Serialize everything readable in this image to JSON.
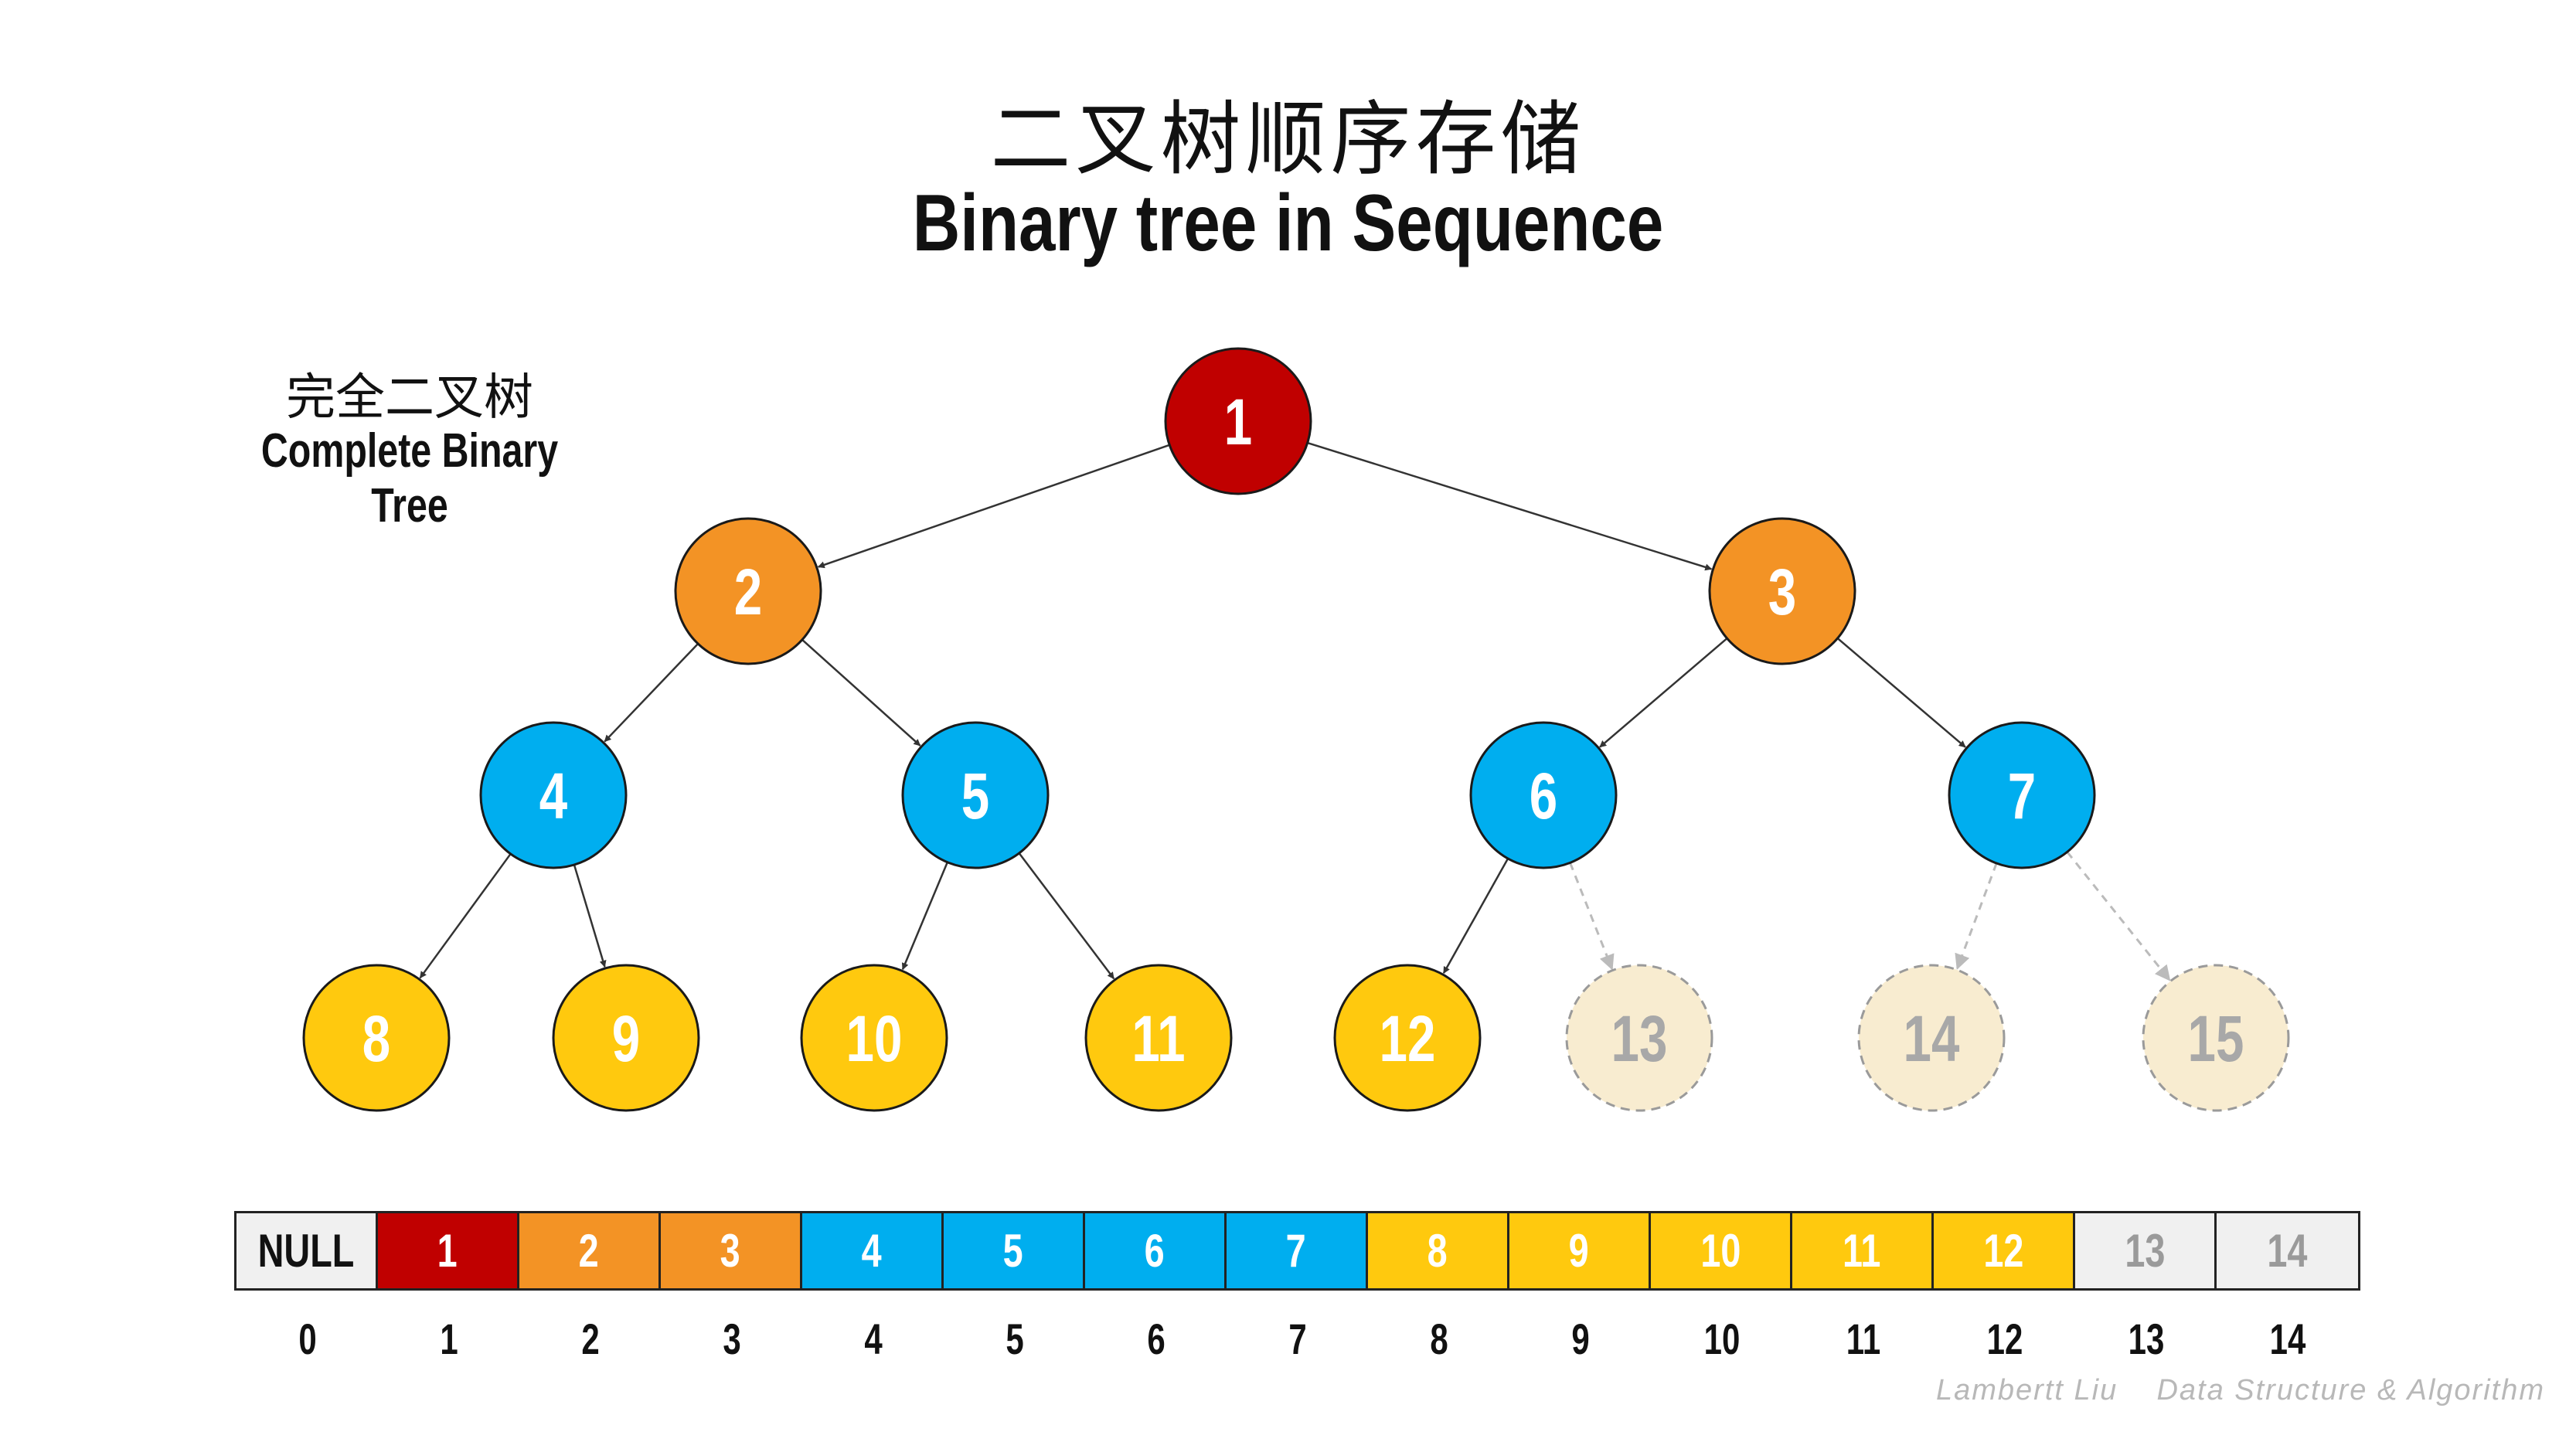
{
  "title_zh": "二叉树顺序存储",
  "title_en": "Binary tree in Sequence",
  "subtitle_zh": "完全二叉树",
  "subtitle_en": "Complete Binary Tree",
  "colors": {
    "level1": "#c00000",
    "level2": "#f39325",
    "level3": "#00aeef",
    "level4": "#ffc90e",
    "ghost_fill": "#f8ecd0",
    "null_fill": "#f0f0f0",
    "edge": "#333333",
    "ghost_edge": "#bbbbbb"
  },
  "tree_nodes": [
    {
      "label": "1",
      "color": "#c00000",
      "present": true
    },
    {
      "label": "2",
      "color": "#f39325",
      "present": true
    },
    {
      "label": "3",
      "color": "#f39325",
      "present": true
    },
    {
      "label": "4",
      "color": "#00aeef",
      "present": true
    },
    {
      "label": "5",
      "color": "#00aeef",
      "present": true
    },
    {
      "label": "6",
      "color": "#00aeef",
      "present": true
    },
    {
      "label": "7",
      "color": "#00aeef",
      "present": true
    },
    {
      "label": "8",
      "color": "#ffc90e",
      "present": true
    },
    {
      "label": "9",
      "color": "#ffc90e",
      "present": true
    },
    {
      "label": "10",
      "color": "#ffc90e",
      "present": true
    },
    {
      "label": "11",
      "color": "#ffc90e",
      "present": true
    },
    {
      "label": "12",
      "color": "#ffc90e",
      "present": true
    },
    {
      "label": "13",
      "color": "#f8ecd0",
      "present": false
    },
    {
      "label": "14",
      "color": "#f8ecd0",
      "present": false
    },
    {
      "label": "15",
      "color": "#f8ecd0",
      "present": false
    }
  ],
  "array_cells": [
    {
      "label": "NULL",
      "color": "#f0f0f0",
      "kind": "null"
    },
    {
      "label": "1",
      "color": "#c00000",
      "kind": "value"
    },
    {
      "label": "2",
      "color": "#f39325",
      "kind": "value"
    },
    {
      "label": "3",
      "color": "#f39325",
      "kind": "value"
    },
    {
      "label": "4",
      "color": "#00aeef",
      "kind": "value"
    },
    {
      "label": "5",
      "color": "#00aeef",
      "kind": "value"
    },
    {
      "label": "6",
      "color": "#00aeef",
      "kind": "value"
    },
    {
      "label": "7",
      "color": "#00aeef",
      "kind": "value"
    },
    {
      "label": "8",
      "color": "#ffc90e",
      "kind": "value"
    },
    {
      "label": "9",
      "color": "#ffc90e",
      "kind": "value"
    },
    {
      "label": "10",
      "color": "#ffc90e",
      "kind": "value"
    },
    {
      "label": "11",
      "color": "#ffc90e",
      "kind": "value"
    },
    {
      "label": "12",
      "color": "#ffc90e",
      "kind": "value"
    },
    {
      "label": "13",
      "color": "#f0f0f0",
      "kind": "ghost"
    },
    {
      "label": "14",
      "color": "#f0f0f0",
      "kind": "ghost"
    }
  ],
  "array_indices": [
    "0",
    "1",
    "2",
    "3",
    "4",
    "5",
    "6",
    "7",
    "8",
    "9",
    "10",
    "11",
    "12",
    "13",
    "14"
  ],
  "footer": "Lambertt Liu    Data Structure & Algorithm"
}
